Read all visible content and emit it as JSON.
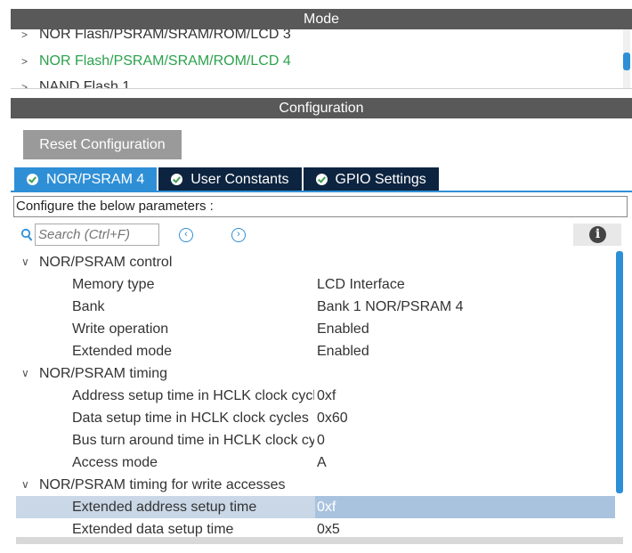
{
  "mode": {
    "header": "Mode",
    "items": [
      {
        "label": "NOR Flash/PSRAM/SRAM/ROM/LCD 3",
        "selected": false
      },
      {
        "label": "NOR Flash/PSRAM/SRAM/ROM/LCD 4",
        "selected": true
      },
      {
        "label": "NAND Flash 1",
        "selected": false
      }
    ]
  },
  "configuration": {
    "header": "Configuration",
    "reset_label": "Reset Configuration",
    "tabs": [
      {
        "label": "NOR/PSRAM 4",
        "active": true
      },
      {
        "label": "User Constants",
        "active": false
      },
      {
        "label": "GPIO Settings",
        "active": false
      }
    ],
    "description": "Configure the below parameters :",
    "search_placeholder": "Search (Ctrl+F)",
    "nav_prev_icon": "chevron-left-circle-icon",
    "nav_next_icon": "chevron-right-circle-icon",
    "info_icon": "info-icon"
  },
  "tree": {
    "groups": [
      {
        "name": "NOR/PSRAM control",
        "params": [
          {
            "name": "Memory type",
            "value": "LCD Interface"
          },
          {
            "name": "Bank",
            "value": "Bank 1 NOR/PSRAM 4"
          },
          {
            "name": "Write operation",
            "value": "Enabled"
          },
          {
            "name": "Extended mode",
            "value": "Enabled"
          }
        ]
      },
      {
        "name": "NOR/PSRAM timing",
        "params": [
          {
            "name": "Address setup time in HCLK clock cycl.",
            "value": "0xf"
          },
          {
            "name": "Data setup time in HCLK clock cycles",
            "value": "0x60"
          },
          {
            "name": "Bus turn around time in HCLK clock cyc",
            "value": "0"
          },
          {
            "name": "Access mode",
            "value": "A"
          }
        ]
      },
      {
        "name": "NOR/PSRAM timing for write accesses",
        "params": [
          {
            "name": "Extended address setup time",
            "value": "0xf",
            "highlighted": true
          },
          {
            "name": "Extended data setup time",
            "value": "0x5"
          }
        ]
      }
    ]
  },
  "colors": {
    "accent": "#2f8fd6",
    "section_bar": "#595959",
    "selected_mode": "#2ba24c",
    "inactive_tab": "#0d2440",
    "highlight_row": "#c9d7e6"
  }
}
